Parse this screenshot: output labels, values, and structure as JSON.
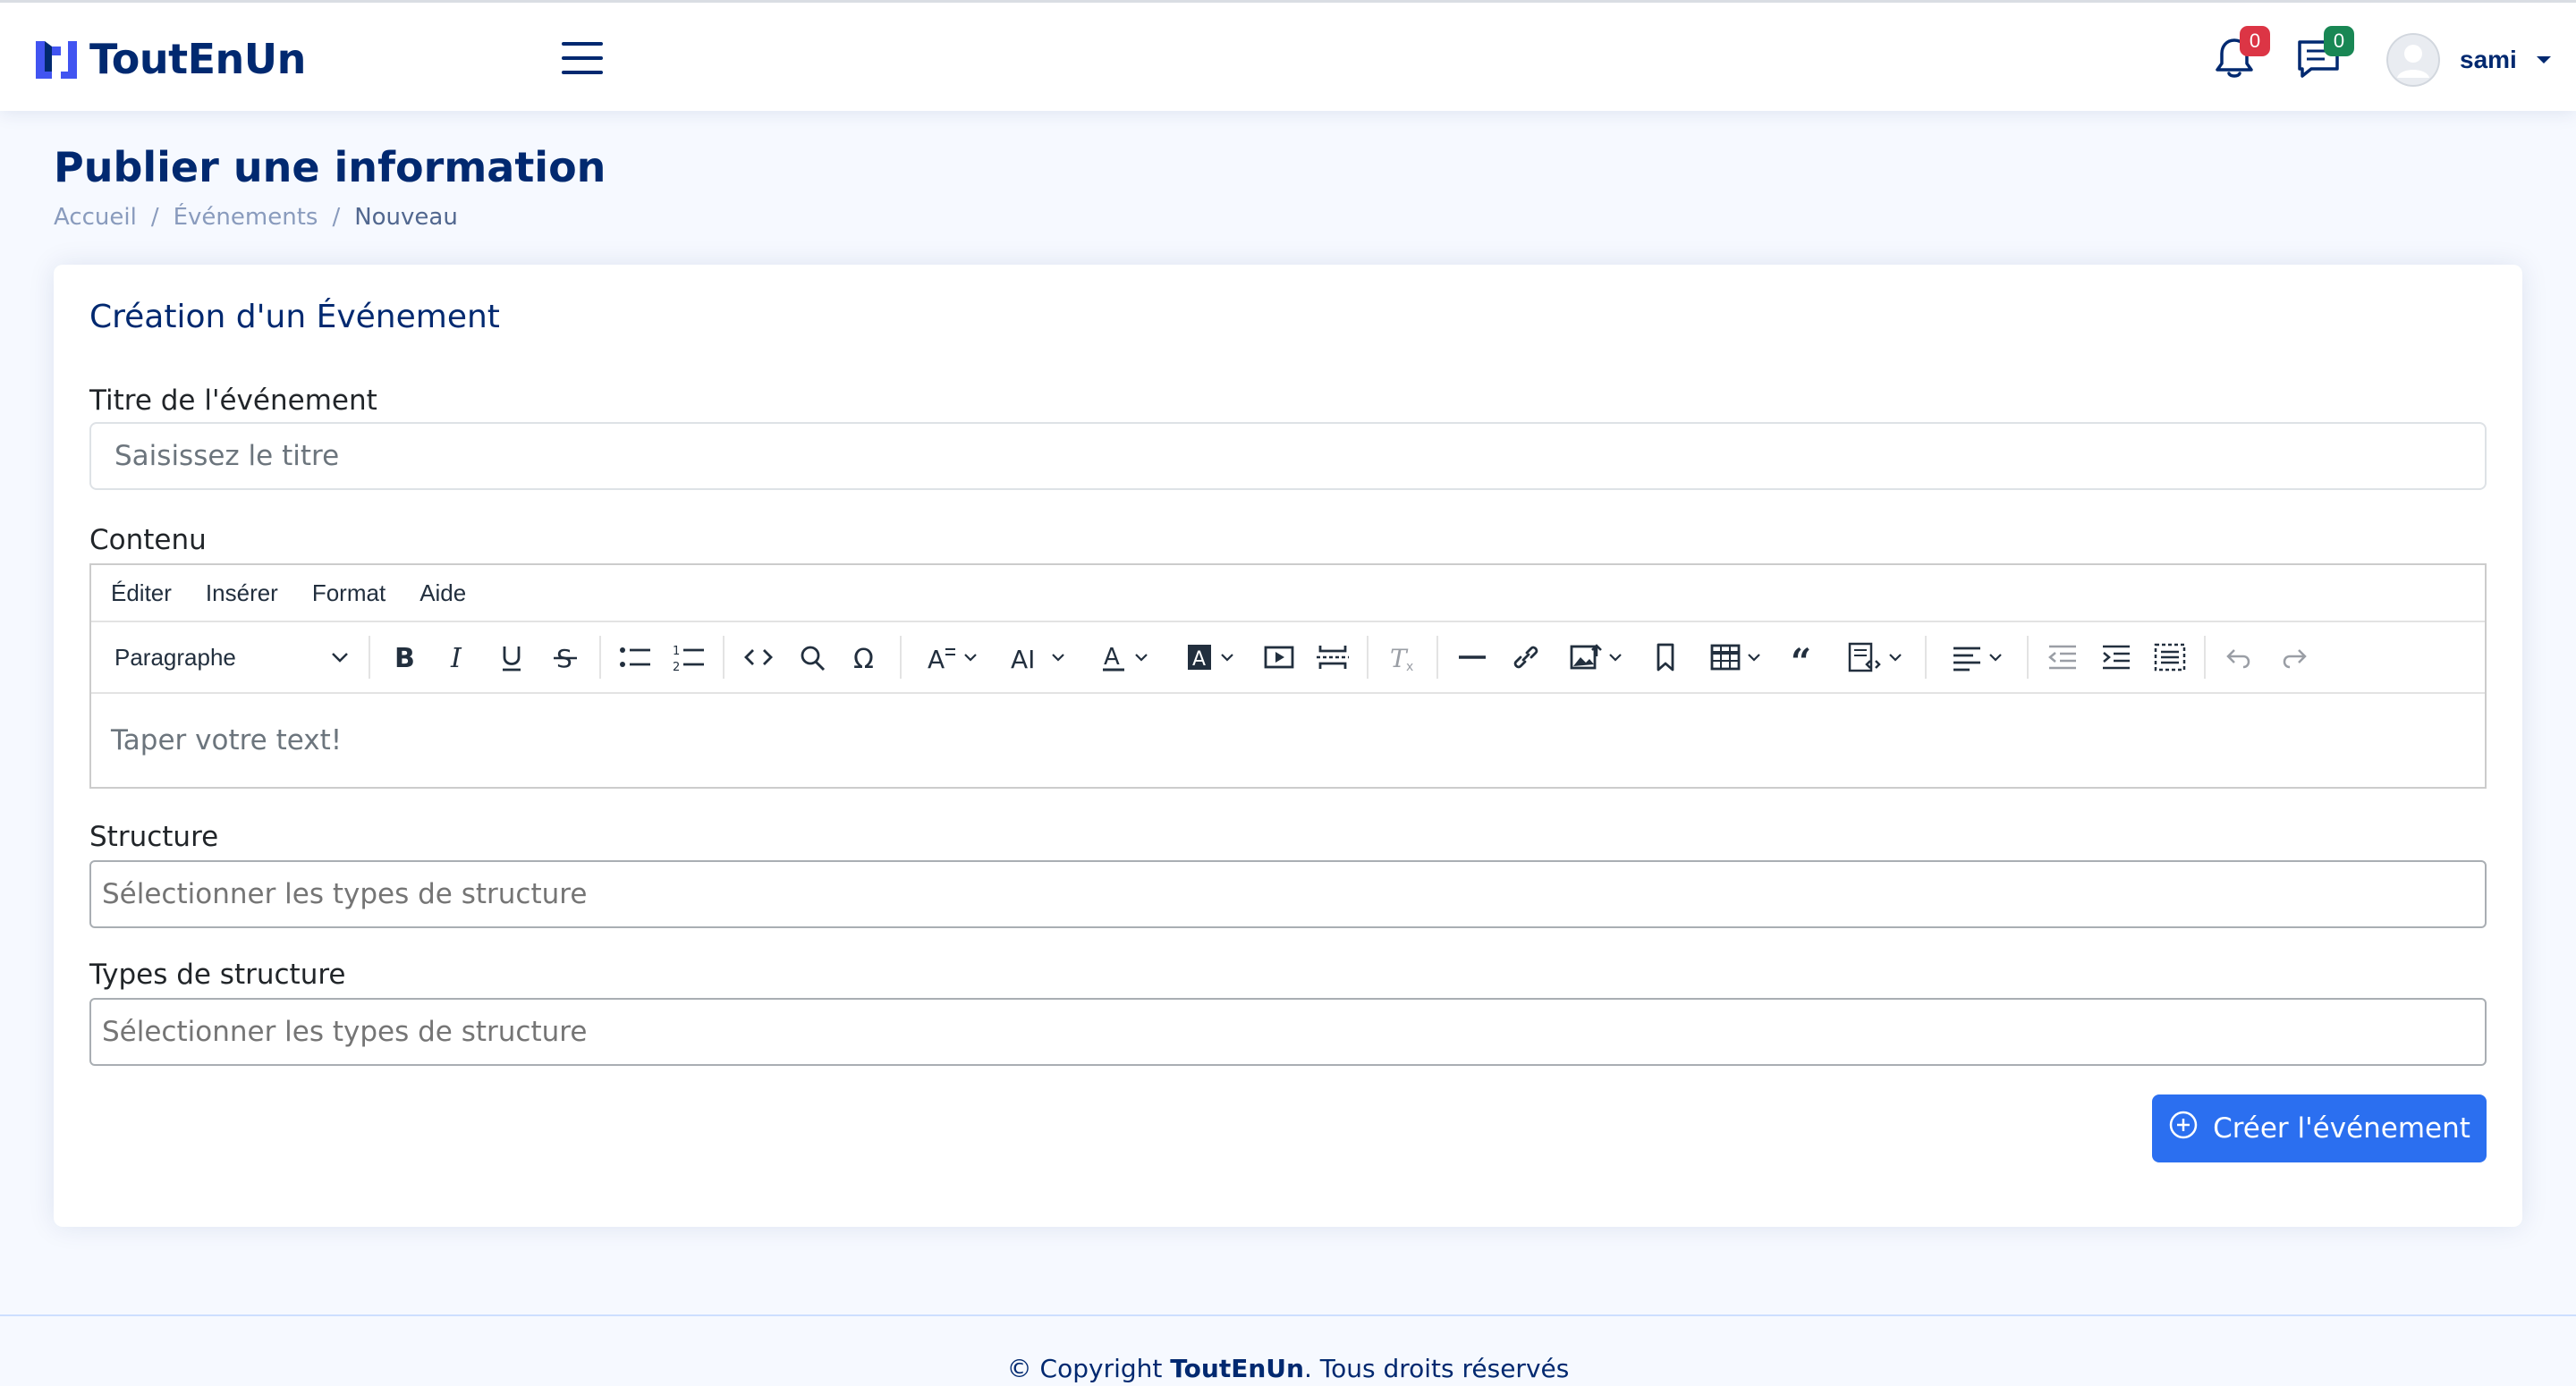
{
  "app": {
    "name": "ToutEnUn"
  },
  "header": {
    "notifications_count": "0",
    "messages_count": "0",
    "user_name": "sami"
  },
  "page": {
    "title": "Publier une information",
    "breadcrumb": [
      "Accueil",
      "Événements",
      "Nouveau"
    ]
  },
  "form": {
    "card_title": "Création d'un Événement",
    "title_label": "Titre de l'événement",
    "title_placeholder": "Saisissez le titre",
    "content_label": "Contenu",
    "editor": {
      "menu": [
        "Éditer",
        "Insérer",
        "Format",
        "Aide"
      ],
      "block_format": "Paragraphe",
      "placeholder": "Taper votre text!"
    },
    "structure_label": "Structure",
    "structure_placeholder": "Sélectionner les types de structure",
    "types_label": "Types de structure",
    "types_placeholder": "Sélectionner les types de structure",
    "submit_label": "Créer l'événement"
  },
  "footer": {
    "prefix": "© Copyright ",
    "brand": "ToutEnUn",
    "suffix": ". Tous droits réservés"
  },
  "colors": {
    "primary_navy": "#012970",
    "button_blue": "#2b6ff0",
    "badge_red": "#dc3545",
    "badge_green": "#198754"
  },
  "icons": [
    "logo-icon",
    "menu-icon",
    "bell-icon",
    "chat-icon",
    "user-avatar-icon",
    "plus-circle-icon"
  ]
}
